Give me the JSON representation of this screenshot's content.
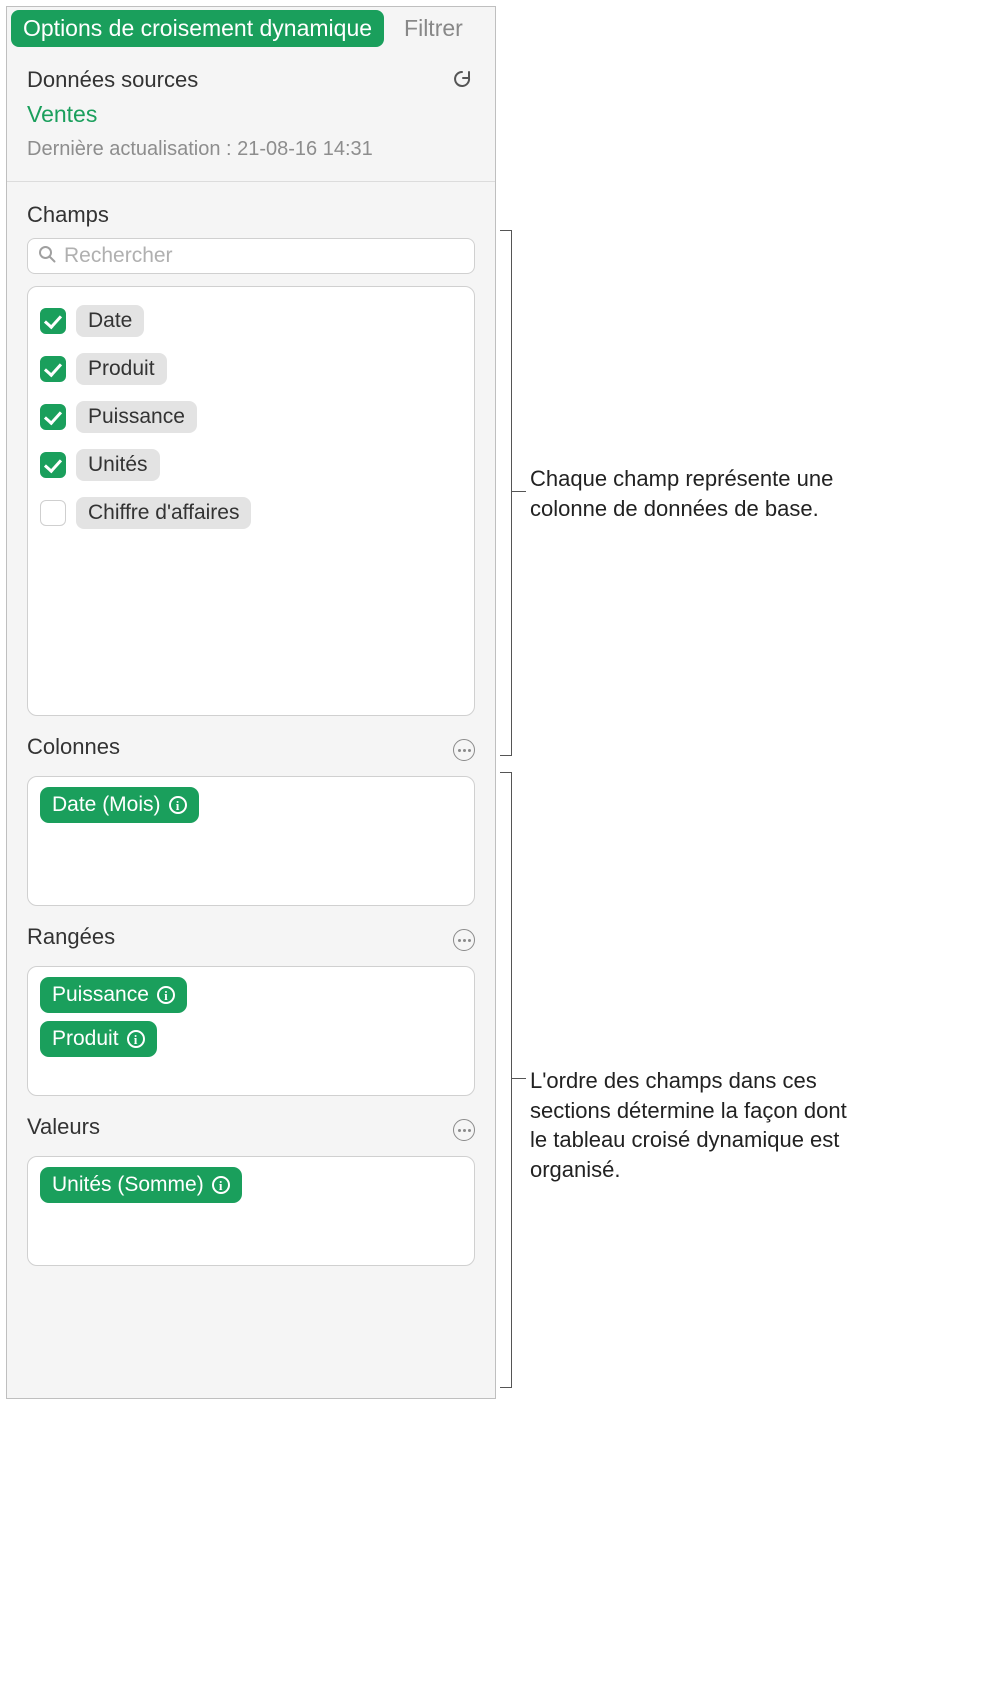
{
  "tabs": {
    "options": "Options de croisement dynamique",
    "filter": "Filtrer"
  },
  "source": {
    "title": "Données sources",
    "name": "Ventes",
    "updated": "Dernière actualisation : 21-08-16 14:31"
  },
  "fields": {
    "title": "Champs",
    "search_placeholder": "Rechercher",
    "items": [
      {
        "label": "Date",
        "checked": true
      },
      {
        "label": "Produit",
        "checked": true
      },
      {
        "label": "Puissance",
        "checked": true
      },
      {
        "label": "Unités",
        "checked": true
      },
      {
        "label": "Chiffre d'affaires",
        "checked": false
      }
    ]
  },
  "columns": {
    "title": "Colonnes",
    "items": [
      {
        "label": "Date (Mois)"
      }
    ]
  },
  "rows": {
    "title": "Rangées",
    "items": [
      {
        "label": "Puissance"
      },
      {
        "label": "Produit"
      }
    ]
  },
  "values": {
    "title": "Valeurs",
    "items": [
      {
        "label": "Unités (Somme)"
      }
    ]
  },
  "annotations": {
    "fields": "Chaque champ représente une colonne de données de base.",
    "sections": "L'ordre des champs dans ces sections détermine la façon dont le tableau croisé dynamique est organisé."
  }
}
